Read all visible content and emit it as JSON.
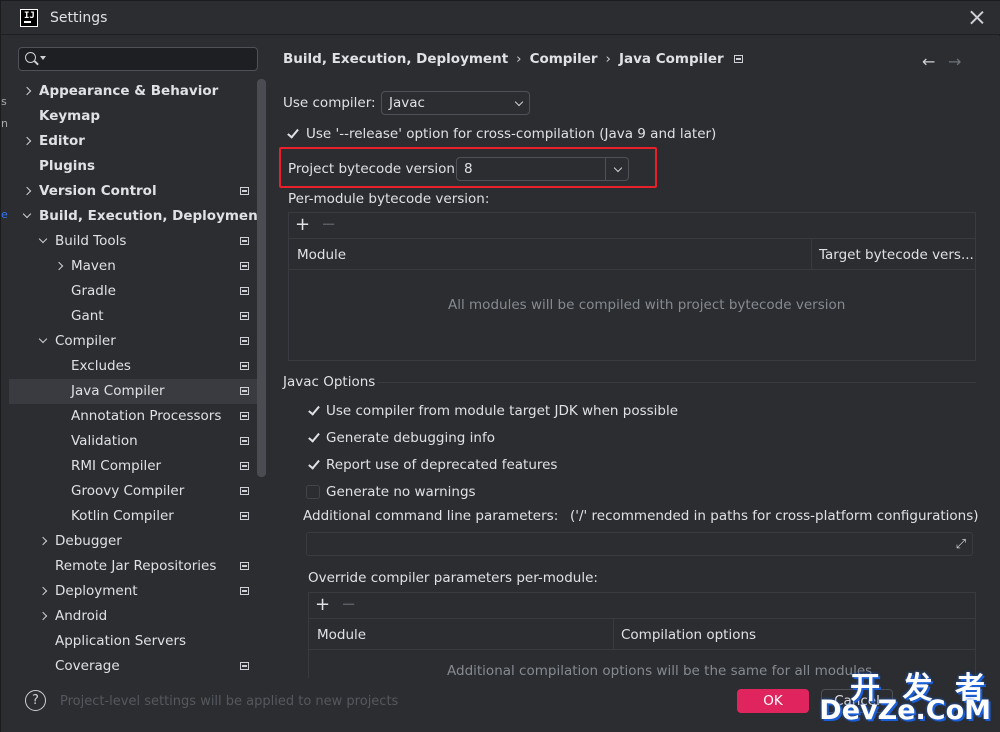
{
  "window": {
    "title": "Settings"
  },
  "peek": {
    "s": "s",
    "n": "n",
    "e": "e"
  },
  "sidebar": {
    "search_placeholder": "",
    "items": [
      {
        "label": "Appearance & Behavior",
        "bold": true,
        "chevron": "right",
        "icon": false
      },
      {
        "label": "Keymap",
        "bold": true,
        "chevron": "none",
        "icon": false
      },
      {
        "label": "Editor",
        "bold": true,
        "chevron": "right",
        "icon": false
      },
      {
        "label": "Plugins",
        "bold": true,
        "chevron": "none",
        "icon": false
      },
      {
        "label": "Version Control",
        "bold": true,
        "chevron": "right",
        "icon": true
      },
      {
        "label": "Build, Execution, Deployment",
        "bold": true,
        "chevron": "down",
        "icon": false
      },
      {
        "label": "Build Tools",
        "bold": false,
        "chevron": "down",
        "icon": true
      },
      {
        "label": "Maven",
        "bold": false,
        "chevron": "right",
        "icon": true
      },
      {
        "label": "Gradle",
        "bold": false,
        "chevron": "none",
        "icon": true
      },
      {
        "label": "Gant",
        "bold": false,
        "chevron": "none",
        "icon": true
      },
      {
        "label": "Compiler",
        "bold": false,
        "chevron": "down",
        "icon": true
      },
      {
        "label": "Excludes",
        "bold": false,
        "chevron": "none",
        "icon": true
      },
      {
        "label": "Java Compiler",
        "bold": false,
        "chevron": "none",
        "icon": true,
        "selected": true
      },
      {
        "label": "Annotation Processors",
        "bold": false,
        "chevron": "none",
        "icon": true
      },
      {
        "label": "Validation",
        "bold": false,
        "chevron": "none",
        "icon": true
      },
      {
        "label": "RMI Compiler",
        "bold": false,
        "chevron": "none",
        "icon": true
      },
      {
        "label": "Groovy Compiler",
        "bold": false,
        "chevron": "none",
        "icon": true
      },
      {
        "label": "Kotlin Compiler",
        "bold": false,
        "chevron": "none",
        "icon": true
      },
      {
        "label": "Debugger",
        "bold": false,
        "chevron": "right",
        "icon": false
      },
      {
        "label": "Remote Jar Repositories",
        "bold": false,
        "chevron": "none",
        "icon": true
      },
      {
        "label": "Deployment",
        "bold": false,
        "chevron": "right",
        "icon": true
      },
      {
        "label": "Android",
        "bold": false,
        "chevron": "right",
        "icon": false
      },
      {
        "label": "Application Servers",
        "bold": false,
        "chevron": "none",
        "icon": false
      },
      {
        "label": "Coverage",
        "bold": false,
        "chevron": "none",
        "icon": true
      }
    ]
  },
  "breadcrumb": {
    "parts": [
      "Build, Execution, Deployment",
      "Compiler",
      "Java Compiler"
    ],
    "separator": "›",
    "back": "←",
    "forward": "→"
  },
  "form": {
    "use_compiler_label": "Use compiler:",
    "use_compiler_value": "Javac",
    "release_option_label": "Use '--release' option for cross-compilation (Java 9 and later)",
    "bytecode_label": "Project bytecode version:",
    "bytecode_value": "8",
    "per_module_label": "Per-module bytecode version:",
    "per_module_table": {
      "add": "+",
      "remove": "−",
      "columns": [
        "Module",
        "Target bytecode vers..."
      ],
      "empty_text": "All modules will be compiled with project bytecode version"
    },
    "javac_section": "Javac Options",
    "javac_options": [
      {
        "label": "Use compiler from module target JDK when possible",
        "checked": true
      },
      {
        "label": "Generate debugging info",
        "checked": true
      },
      {
        "label": "Report use of deprecated features",
        "checked": true
      },
      {
        "label": "Generate no warnings",
        "checked": false
      }
    ],
    "additional_params_label": "Additional command line parameters:",
    "additional_params_hint": "('/' recommended in paths for cross-platform configurations)",
    "additional_params_value": "",
    "expand_icon": "⤢",
    "override_label": "Override compiler parameters per-module:",
    "override_table": {
      "add": "+",
      "remove": "−",
      "columns": [
        "Module",
        "Compilation options"
      ],
      "empty_text": "Additional compilation options will be the same for all modules"
    }
  },
  "bottom": {
    "help": "?",
    "hint": "Project-level settings will be applied to new projects",
    "ok": "OK",
    "cancel": "Cancel"
  },
  "watermark": {
    "top": "开 发 者",
    "bottom": "DevZe.CoM"
  },
  "colors": {
    "accent": "#e0245e",
    "highlight": "#e8202a",
    "selection": "#393b40"
  }
}
